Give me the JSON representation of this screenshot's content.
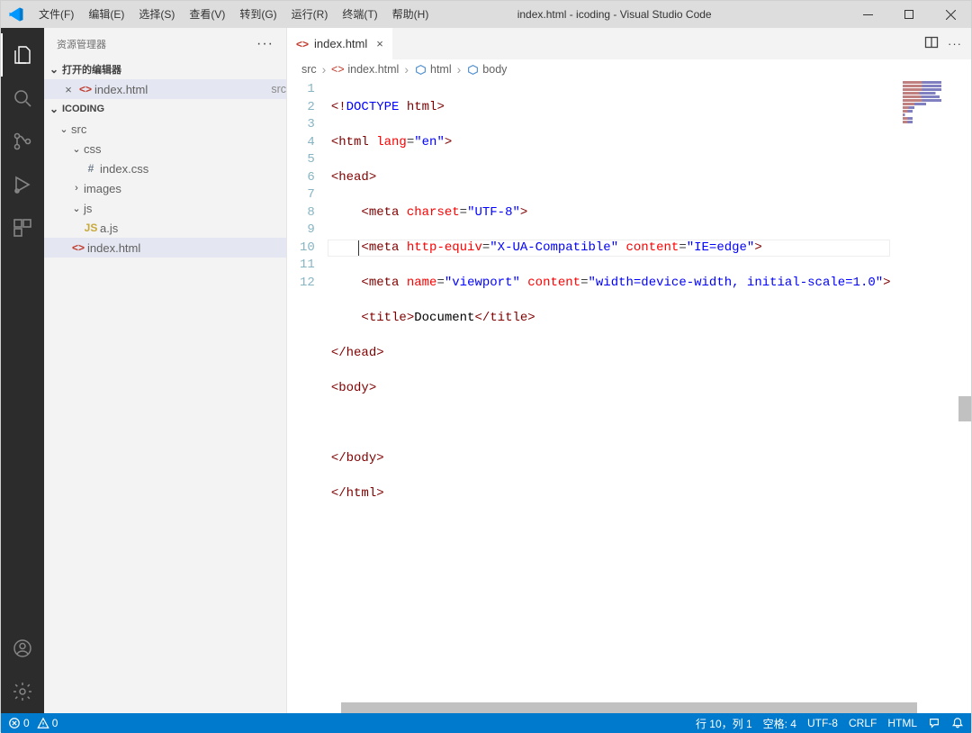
{
  "title": "index.html - icoding - Visual Studio Code",
  "menu": [
    "文件(F)",
    "编辑(E)",
    "选择(S)",
    "查看(V)",
    "转到(G)",
    "运行(R)",
    "终端(T)",
    "帮助(H)"
  ],
  "sidebar": {
    "title": "资源管理器",
    "openEditorsHeader": "打开的编辑器",
    "openEditors": [
      {
        "name": "index.html",
        "desc": "src"
      }
    ],
    "projectHeader": "ICODING",
    "tree": {
      "src": "src",
      "css": "css",
      "indexcss": "index.css",
      "images": "images",
      "js": "js",
      "ajs": "a.js",
      "indexhtml": "index.html"
    }
  },
  "tab": {
    "name": "index.html"
  },
  "breadcrumbs": {
    "src": "src",
    "file": "index.html",
    "html": "html",
    "body": "body"
  },
  "lines": [
    "1",
    "2",
    "3",
    "4",
    "5",
    "6",
    "7",
    "8",
    "9",
    "10",
    "11",
    "12"
  ],
  "code": {
    "l1": {
      "a": "<!",
      "b": "DOCTYPE",
      "c": " html",
      "d": ">"
    },
    "l2": {
      "a": "<",
      "b": "html",
      "c": " lang",
      "d": "=",
      "e": "\"en\"",
      "f": ">"
    },
    "l3": {
      "a": "<",
      "b": "head",
      "c": ">"
    },
    "l4": {
      "a": "    <",
      "b": "meta",
      "c": " charset",
      "d": "=",
      "e": "\"UTF-8\"",
      "f": ">"
    },
    "l5": {
      "a": "    <",
      "b": "meta",
      "c": " http-equiv",
      "d": "=",
      "e": "\"X-UA-Compatible\"",
      "f": " content",
      "g": "=",
      "h": "\"IE=edge\"",
      "i": ">"
    },
    "l6": {
      "a": "    <",
      "b": "meta",
      "c": " name",
      "d": "=",
      "e": "\"viewport\"",
      "f": " content",
      "g": "=",
      "h": "\"width=device-width, initial-scale=1.0\"",
      "i": ">"
    },
    "l7": {
      "a": "    <",
      "b": "title",
      "c": ">",
      "d": "Document",
      "e": "</",
      "f": "title",
      "g": ">"
    },
    "l8": {
      "a": "</",
      "b": "head",
      "c": ">"
    },
    "l9": {
      "a": "<",
      "b": "body",
      "c": ">"
    },
    "l10": "",
    "l11": {
      "a": "</",
      "b": "body",
      "c": ">"
    },
    "l12": {
      "a": "</",
      "b": "html",
      "c": ">"
    }
  },
  "status": {
    "errors": "0",
    "warnings": "0",
    "lncol": "行 10，列 1",
    "spaces": "空格: 4",
    "encoding": "UTF-8",
    "eol": "CRLF",
    "lang": "HTML"
  }
}
